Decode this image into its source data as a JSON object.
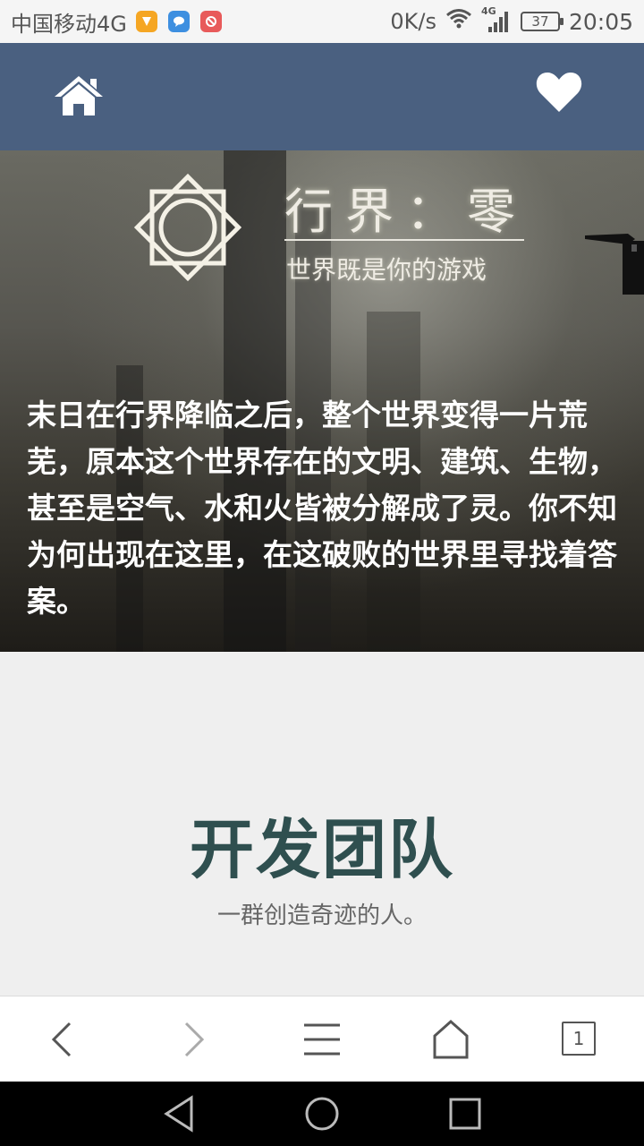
{
  "status_bar": {
    "carrier": "中国移动4G",
    "network_speed": "0K/s",
    "network_type": "4G",
    "battery": "37",
    "time": "20:05",
    "app_icons": [
      "notification-orange-icon",
      "chat-blue-icon",
      "app-red-icon"
    ]
  },
  "app_bar": {
    "background": "#4a6080",
    "home_icon": "home-icon",
    "favorite_icon": "heart-icon"
  },
  "hero": {
    "logo_title": "行界：零",
    "logo_subtitle": "世界既是你的游戏",
    "description": "末日在行界降临之后，整个世界变得一片荒芜，原本这个世界存在的文明、建筑、生物，甚至是空气、水和火皆被分解成了灵。你不知为何出现在这里，在这破败的世界里寻找着答案。"
  },
  "team": {
    "title": "开发团队",
    "subtitle": "一群创造奇迹的人。"
  },
  "browser_toolbar": {
    "tab_count": "1",
    "buttons": [
      "back-icon",
      "forward-icon",
      "menu-icon",
      "home-icon",
      "tabs-icon"
    ]
  },
  "system_nav": {
    "buttons": [
      "back-triangle-icon",
      "home-circle-icon",
      "recents-square-icon"
    ]
  }
}
